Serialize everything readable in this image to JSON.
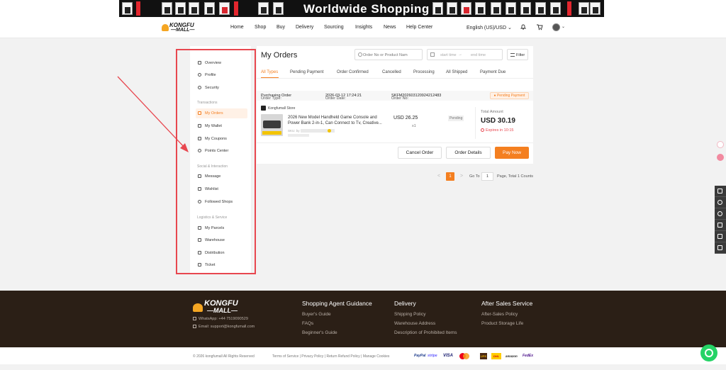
{
  "banner": {
    "title": "Worldwide Shopping"
  },
  "header": {
    "logo_line1": "KONGFU",
    "logo_line2": "—MALL—",
    "nav": [
      "Home",
      "Shop",
      "Buy",
      "Delivery",
      "Sourcing",
      "Insights",
      "News",
      "Help Center"
    ],
    "language": "English (US)/USD ⌄"
  },
  "sidebar": {
    "items": [
      {
        "label": "Overview",
        "icon": "grid-icon"
      },
      {
        "label": "Profile",
        "icon": "user-icon"
      },
      {
        "label": "Security",
        "icon": "shield-icon"
      },
      {
        "label": "My Orders",
        "icon": "orders-icon",
        "active": true
      },
      {
        "label": "My Wallet",
        "icon": "wallet-icon"
      },
      {
        "label": "My Coupons",
        "icon": "coupon-icon"
      },
      {
        "label": "Points Center",
        "icon": "points-icon"
      },
      {
        "label": "Message",
        "icon": "bell-icon"
      },
      {
        "label": "Wishlist",
        "icon": "heart-icon"
      },
      {
        "label": "Followed Shops",
        "icon": "shop-icon"
      },
      {
        "label": "My Parcels",
        "icon": "parcel-icon"
      },
      {
        "label": "Warehouse",
        "icon": "warehouse-icon"
      },
      {
        "label": "Distribution",
        "icon": "distribution-icon"
      },
      {
        "label": "Ticket",
        "icon": "ticket-icon"
      }
    ],
    "groups": [
      "Transactions",
      "Social & Interaction",
      "Logistics & Service"
    ]
  },
  "orders": {
    "title": "My Orders",
    "search_placeholder": "Order No or Product Nam",
    "start_placeholder": "start time",
    "separator": "→",
    "end_placeholder": "end time",
    "filter_label": "Filter",
    "tabs": [
      "All Types",
      "Pending Payment",
      "Order Confirmed",
      "Cancelled",
      "Processing",
      "All Shipped",
      "Payment Due"
    ],
    "order": {
      "type_label": "Order Type:",
      "type_value": "Purchasing Order",
      "date_label": "Order Date:",
      "date_value": "2026-03-12 17:24:21",
      "no_label": "Order No:",
      "no_value": "SKFM202603120924212483",
      "badge": "● Pending Payment",
      "store": "Kongfumall Store",
      "product_name": "2026 New Model Handheld Game Console and Power Bank 2-in-1, Can Connect to Tv, Creative...",
      "spec_label": "SKU: by color",
      "unit_price": "USD 26.25",
      "quantity": "x1",
      "status": "Pending",
      "total_label": "Total Amount",
      "total_value": "USD 30.19",
      "expires": "Expires in 10:15",
      "cancel_btn": "Cancel Order",
      "details_btn": "Order Details",
      "pay_btn": "Pay Now"
    }
  },
  "pagination": {
    "prev": "<",
    "page": "1",
    "next": ">",
    "goto": "Go To",
    "input_value": "1",
    "total": "Page, Total 1 Counts"
  },
  "footer": {
    "logo_line1": "KONGFU",
    "logo_line2": "—MALL—",
    "whatsapp": "WhatsApp: +44 7519090529",
    "email": "Email: support@kongfumall.com",
    "col1_title": "Shopping Agent Guidance",
    "col1_links": [
      "Buyer's Guide",
      "FAQs",
      "Beginner's Guide"
    ],
    "col2_title": "Delivery",
    "col2_links": [
      "Shipping Policy",
      "Warehouse Address",
      "Description of Prohibited Items"
    ],
    "col3_title": "After Sales Service",
    "col3_links": [
      "After-Sales Policy",
      "Product Storage Life"
    ],
    "copyright": "© 2026 kongfumall All Rights Reserved",
    "legal_links": "Terms of Service | Privacy Policy | Return Refund Policy | Manage Cookies",
    "payments": [
      "PayPal",
      "stripe",
      "VISA",
      "Mastercard",
      "UPS",
      "DHL",
      "amazon",
      "FedEx"
    ]
  },
  "colors": {
    "accent": "#f47f20",
    "annotation": "#e8474f",
    "footer_bg": "#2b1f16"
  }
}
